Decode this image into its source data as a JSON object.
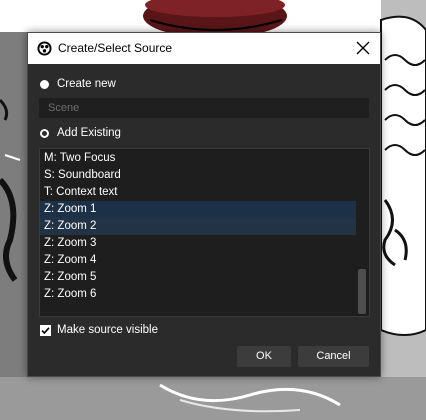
{
  "dialog": {
    "title": "Create/Select Source",
    "create_new_label": "Create new",
    "scene_placeholder": "Scene",
    "add_existing_label": "Add Existing",
    "sources": [
      "M: Two Focus",
      "S: Soundboard",
      "T: Context text",
      "Z: Zoom 1",
      "Z: Zoom 2",
      "Z: Zoom 3",
      "Z: Zoom 4",
      "Z: Zoom 5",
      "Z: Zoom 6"
    ],
    "selected_items": [
      "Z: Zoom 1",
      "Z: Zoom 2"
    ],
    "make_visible_label": "Make source visible",
    "make_visible_checked": true,
    "ok_label": "OK",
    "cancel_label": "Cancel",
    "selected_radio": "Add Existing"
  },
  "colors": {
    "dialog_bg": "#2b2b2b",
    "selection": "#1c3148",
    "button": "#3c3c3c"
  }
}
